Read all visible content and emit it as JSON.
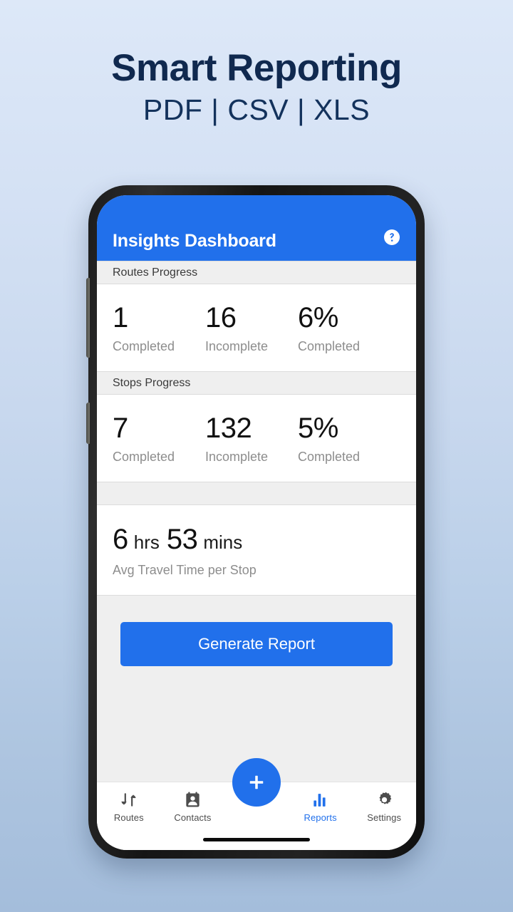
{
  "promo": {
    "title": "Smart Reporting",
    "subtitle": "PDF | CSV | XLS"
  },
  "colors": {
    "brand_blue": "#2170eb",
    "promo_navy": "#10294f",
    "section_band": "#efefef",
    "muted_text": "#8d8d8d"
  },
  "appbar": {
    "title": "Insights Dashboard",
    "help_icon": "help-circle-icon"
  },
  "sections": [
    {
      "header": "Routes Progress",
      "stats": [
        {
          "value": "1",
          "label": "Completed"
        },
        {
          "value": "16",
          "label": "Incomplete"
        },
        {
          "value": "6%",
          "label": "Completed"
        }
      ]
    },
    {
      "header": "Stops Progress",
      "stats": [
        {
          "value": "7",
          "label": "Completed"
        },
        {
          "value": "132",
          "label": "Incomplete"
        },
        {
          "value": "5%",
          "label": "Completed"
        }
      ]
    }
  ],
  "travel": {
    "header": "",
    "hours_value": "6",
    "hours_unit": "hrs",
    "mins_value": "53",
    "mins_unit": "mins",
    "label": "Avg Travel Time per Stop"
  },
  "actions": {
    "generate_report": "Generate Report"
  },
  "fab": {
    "icon": "plus-icon"
  },
  "bottom_nav": {
    "items": [
      {
        "label": "Routes",
        "icon": "swap-arrows-icon",
        "active": false
      },
      {
        "label": "Contacts",
        "icon": "contact-card-icon",
        "active": false
      },
      {
        "label": "Reports",
        "icon": "bar-chart-icon",
        "active": true
      },
      {
        "label": "Settings",
        "icon": "gear-icon",
        "active": false
      }
    ]
  }
}
